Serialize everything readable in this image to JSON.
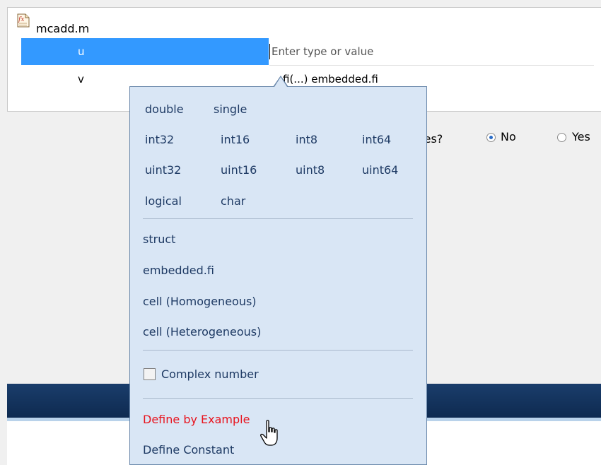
{
  "file": {
    "name": "mcadd.m",
    "icon": "function-file-icon"
  },
  "variables": [
    {
      "name": "u",
      "value_placeholder": "Enter type or value",
      "selected": true
    },
    {
      "name": "v",
      "value": "fi(...) embedded.fi"
    }
  ],
  "question": {
    "text": "Does this code use global variables?",
    "visible_text": "bles?"
  },
  "radio": {
    "no_label": "No",
    "yes_label": "Yes",
    "selected": "No"
  },
  "type_menu": {
    "numeric_rows": [
      [
        "double",
        "single"
      ],
      [
        "int32",
        "int16",
        "int8",
        "int64"
      ],
      [
        "uint32",
        "uint16",
        "uint8",
        "uint64"
      ],
      [
        "logical",
        "char"
      ]
    ],
    "composite": [
      "struct",
      "embedded.fi",
      "cell (Homogeneous)",
      "cell (Heterogeneous)"
    ],
    "complex_label": "Complex number",
    "complex_checked": false,
    "define_by_example": "Define by Example",
    "define_constant": "Define Constant"
  },
  "colors": {
    "selection": "#3399ff",
    "popup_bg": "#d9e6f5",
    "menu_text": "#1e3a64",
    "highlight_text": "#e8141e",
    "dark_band": "#0e2a50"
  }
}
